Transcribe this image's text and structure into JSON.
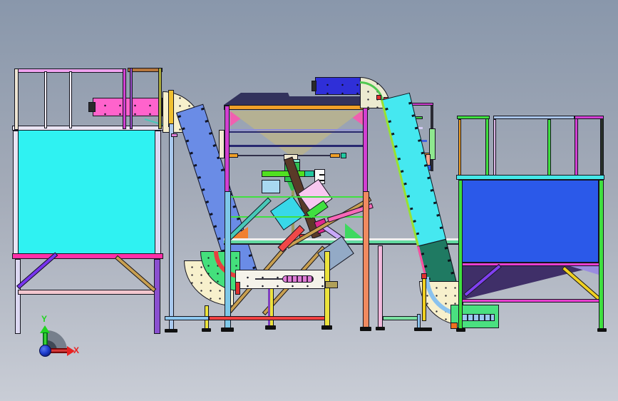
{
  "triad": {
    "y_label": "Y",
    "x_label": "X",
    "y_color": "#21d421",
    "x_color": "#e82222",
    "origin_color": "#1f3fd0",
    "sector_color": "#5c6675"
  },
  "palette": {
    "bg_top": "#8997ab",
    "bg_mid": "#a4abb8",
    "bg_bottom": "#c9cdd6",
    "rail_pink": "#efa2ef",
    "rail_brown": "#b5763c",
    "post_cream": "#efe6d4",
    "post_white": "#f3eff6",
    "post_magenta": "#d23fd2",
    "post_violet": "#9a50c8",
    "post_olive": "#a8a83a",
    "deck_trim": "#e9e5f4",
    "tank_cyan": "#2ff2f2",
    "band_magenta": "#ff2fa8",
    "leg_lavender": "#dcd8f2",
    "leg_purple": "#8a4fd0",
    "rail_pale_pink": "#f2c6ce",
    "brace_purple": "#7733ee",
    "brace_tan": "#c89f50",
    "conveyor_pink": "#ff63cc",
    "motor_dark": "#2a2a2a",
    "curve_cream": "#f7f0cc",
    "post_yellow": "#f0c030",
    "pole_blue": "#a9c9ee",
    "incline_blue": "#6a8ce6",
    "curve_green": "#44e07c",
    "curve_red": "#e84040",
    "conveyor_white": "#f5f3ea",
    "auger_pink": "#e07fd8",
    "block_tan": "#b0a058",
    "leg_yellow": "#ece33c",
    "part_red": "#e03030",
    "rail_red": "#f04040",
    "rail_light_blue": "#8ec8f0",
    "rail_green": "#7ae0a0",
    "slab_navy": "#32325c",
    "beam_orange": "#f0a028",
    "tri_pink": "#f060b0",
    "funnel_tan": "#b5b193",
    "rail_lavender": "#9090d8",
    "rail_navy": "#282870",
    "cyl_green": "#2fc050",
    "cyl_teal": "#80e8c8",
    "neck_cream": "#efe8d0",
    "rod_olive": "#9a9a60",
    "bar_green": "#50e020",
    "bar_teal": "#20c8a0",
    "box_blue": "#a8d8f0",
    "bracket_white": "#f8f8f8",
    "chute_brown": "#5a3a28",
    "panel_pink": "#f8c8f0",
    "panel_cyan": "#38d8e8",
    "strip_green": "#40e040",
    "part_magenta": "#e02890",
    "diag_lavender": "#c8a8f8",
    "deck_green": "#63d9a0",
    "tri_orange": "#f08030",
    "tri_green": "#3fd860",
    "diag_teal": "#48c8b8",
    "plate_steel": "#93aac6",
    "diag_red": "#f04848",
    "diag_pink": "#f868b8",
    "leg_salmon": "#f08a60",
    "leg_pink": "#f2b8dc",
    "leg_lightblue": "#7ec8e8",
    "head_blue": "#2f2fd8",
    "curve_pale": "#ecead0",
    "arc_green": "#50c850",
    "belt_cyan": "#45e8f0",
    "belt_teal": "#1f7a62",
    "edge_pink": "#ff4fa0",
    "edge_green": "#9ae030",
    "guide_blue": "#8ac2ee",
    "conveyor_green": "#4ae080",
    "slat_blue": "#9cc8f0",
    "block_orange": "#f07020",
    "rod_yellow": "#f0d020",
    "stair_rail_magenta": "#d23fd2",
    "stair_rail_green": "#3fc83f",
    "stair_rail_lavender": "#d3cbf5",
    "stair_rail_blue": "#4060e0",
    "stair_rail_orange": "#f0a040",
    "stair_panel_green": "#8fe88f",
    "stair_panel_salmon": "#f8a890",
    "stair_step_blue": "#2f5ae8",
    "guard_green": "#3fe03f",
    "guard_orange": "#f0a028",
    "guard_lightblue": "#a8c4e8",
    "guard_lav": "#e0b8e8",
    "guard_magenta": "#d23fd2",
    "guard_dark": "#283028",
    "deck_cyan": "#45e8e8",
    "panel_blue": "#2b59e9",
    "hopper_purple": "#3f2f68",
    "tri_violet": "#9a8ce0",
    "brace_purple2": "#8040f0",
    "brace_yellow": "#f0d020",
    "rail_magenta2": "#e83fd0"
  }
}
